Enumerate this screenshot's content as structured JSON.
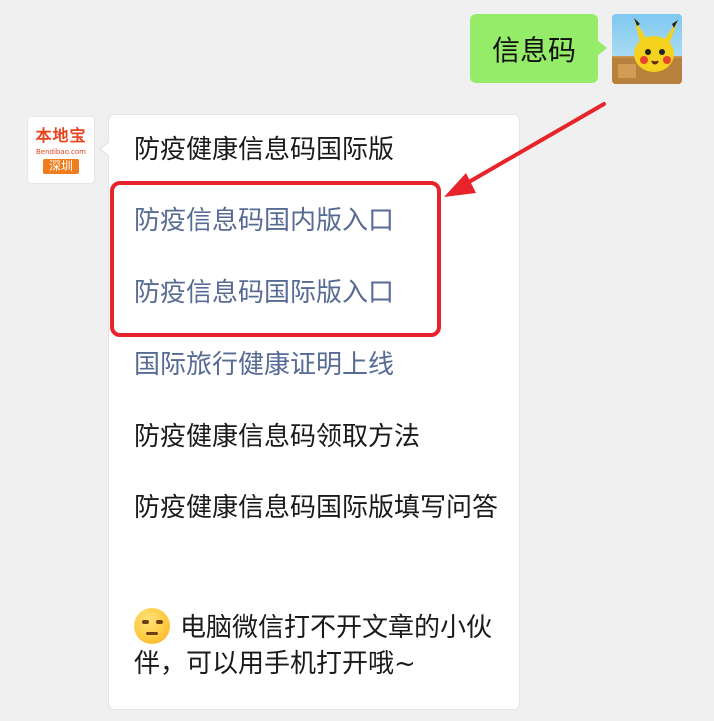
{
  "outgoing": {
    "text": "信息码"
  },
  "incoming": {
    "logo": {
      "brand": "本地宝",
      "sub": "Bendibao.com",
      "city": "深圳"
    },
    "items": [
      {
        "text": "防疫健康信息码国际版",
        "style": "dark"
      },
      {
        "text": "防疫信息码国内版入口",
        "style": "link"
      },
      {
        "text": "防疫信息码国际版入口",
        "style": "link"
      },
      {
        "text": "国际旅行健康证明上线",
        "style": "link"
      },
      {
        "text": "防疫健康信息码领取方法",
        "style": "dark"
      },
      {
        "text": "防疫健康信息码国际版填写问答",
        "style": "dark"
      }
    ],
    "footer_text": "电脑微信打不开文章的小伙伴，可以用手机打开哦~"
  },
  "colors": {
    "bubble_out": "#95ec69",
    "link": "#576b95",
    "highlight": "#e8232b"
  }
}
